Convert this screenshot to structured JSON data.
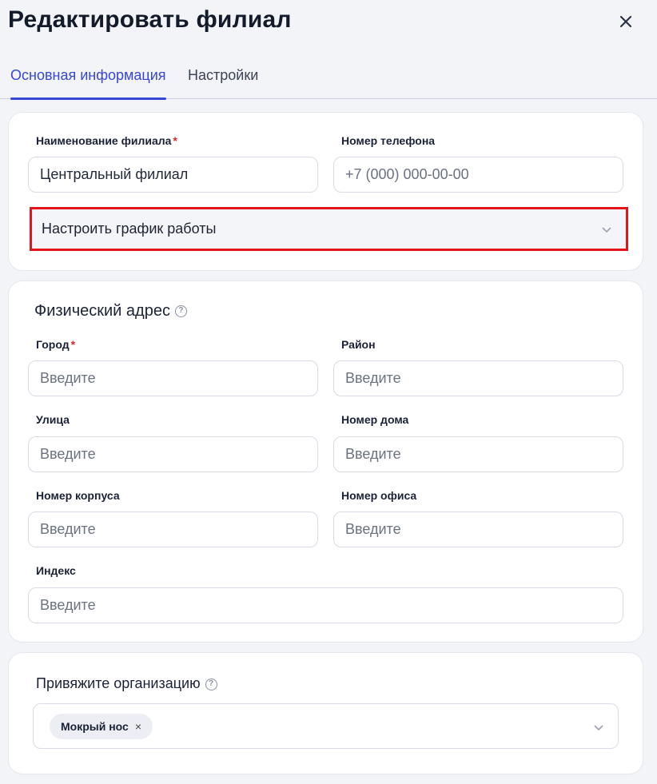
{
  "dialog": {
    "title": "Редактировать филиал",
    "tabs": [
      {
        "label": "Основная информация",
        "active": true
      },
      {
        "label": "Настройки",
        "active": false
      }
    ]
  },
  "basic": {
    "name_label": "Наименование филиала",
    "name_required": "*",
    "name_value": "Центральный филиал",
    "phone_label": "Номер телефона",
    "phone_placeholder": "+7 (000) 000-00-00",
    "schedule_label": "Настроить график работы"
  },
  "address": {
    "title": "Физический адрес",
    "help": "?",
    "placeholder": "Введите",
    "city_label": "Город",
    "city_required": "*",
    "district_label": "Район",
    "street_label": "Улица",
    "house_label": "Номер дома",
    "building_label": "Номер корпуса",
    "office_label": "Номер офиса",
    "index_label": "Индекс"
  },
  "organization": {
    "title": "Привяжите организацию",
    "help": "?",
    "selected": [
      "Мокрый нос"
    ],
    "chip_remove": "×"
  },
  "colors": {
    "accent": "#3846d6",
    "required": "#e0252b",
    "highlight": "#e3151b"
  }
}
